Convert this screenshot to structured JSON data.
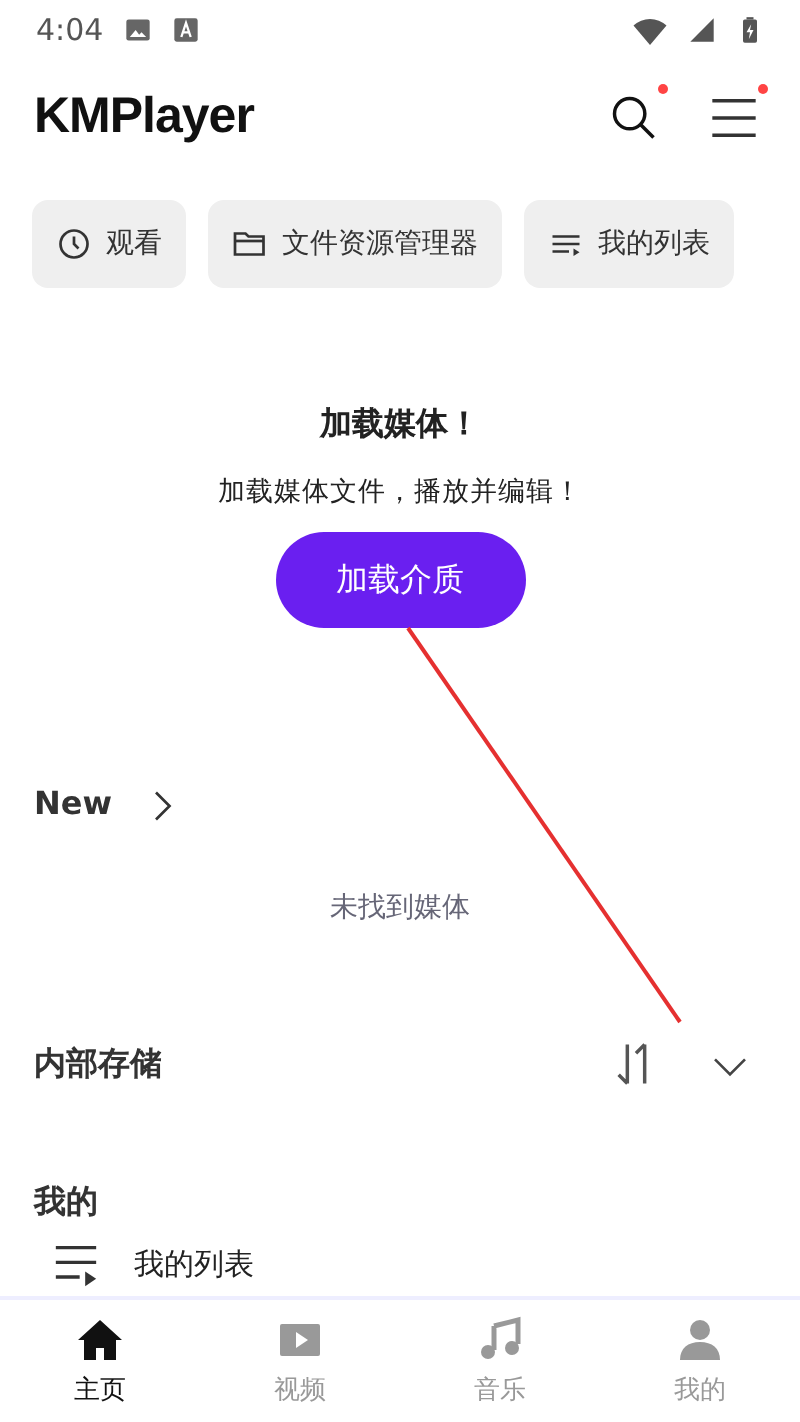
{
  "status_bar": {
    "time": "4:04"
  },
  "app_bar": {
    "logo": "KMPlayer",
    "search_badge": true,
    "menu_badge": true
  },
  "chips": [
    {
      "kind": "clock",
      "label": "观看"
    },
    {
      "kind": "folder",
      "label": "文件资源管理器"
    },
    {
      "kind": "list",
      "label": "我的列表"
    }
  ],
  "empty_state": {
    "title": "加载媒体！",
    "subtitle": "加载媒体文件，播放并编辑！",
    "button": "加载介质"
  },
  "new_section": {
    "title": "New",
    "empty_text": "未找到媒体"
  },
  "storage_section": {
    "title": "内部存储",
    "expanded": false
  },
  "my_section": {
    "title": "我的",
    "items": [
      {
        "label": "我的列表"
      }
    ]
  },
  "bottom_nav": [
    {
      "kind": "home",
      "label": "主页",
      "selected": true
    },
    {
      "kind": "video",
      "label": "视频",
      "selected": false
    },
    {
      "kind": "music",
      "label": "音乐",
      "selected": false
    },
    {
      "kind": "person",
      "label": "我的",
      "selected": false
    }
  ]
}
